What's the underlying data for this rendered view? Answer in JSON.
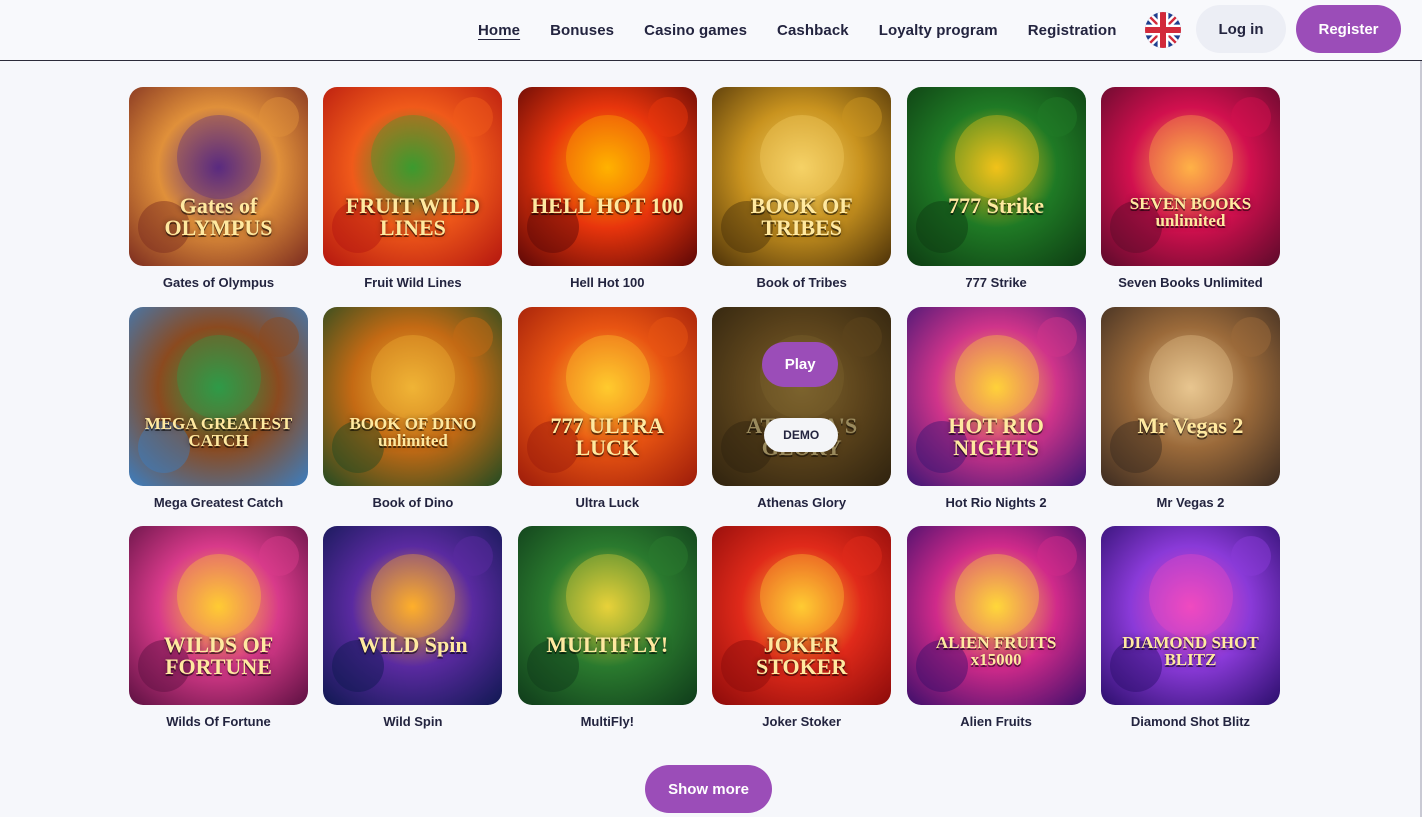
{
  "nav": {
    "items": [
      "Home",
      "Bonuses",
      "Casino games",
      "Cashback",
      "Loyalty program",
      "Registration"
    ],
    "active": "Home"
  },
  "header": {
    "language_icon": "uk-flag-icon",
    "login_label": "Log in",
    "register_label": "Register"
  },
  "colors": {
    "accent": "#9b4db8",
    "text": "#23243f",
    "background": "#f6f7fb"
  },
  "games": [
    {
      "name": "Gates of Olympus",
      "art": "Gates of OLYMPUS",
      "colors": [
        "#7a2a1f",
        "#e0903a",
        "#5a2a80"
      ]
    },
    {
      "name": "Fruit Wild Lines",
      "art": "FRUIT WILD LINES",
      "colors": [
        "#b3150f",
        "#f05a1a",
        "#3b9b2f"
      ]
    },
    {
      "name": "Hell Hot 100",
      "art": "HELL HOT 100",
      "colors": [
        "#5a0606",
        "#e8350c",
        "#ffb300"
      ]
    },
    {
      "name": "Book of Tribes",
      "art": "BOOK OF TRIBES",
      "colors": [
        "#4a3008",
        "#c9931f",
        "#f5d266"
      ]
    },
    {
      "name": "777 Strike",
      "art": "777 Strike",
      "colors": [
        "#0d3a12",
        "#1f7a25",
        "#f2c21a"
      ]
    },
    {
      "name": "Seven Books Unlimited",
      "art": "SEVEN BOOKS unlimited",
      "colors": [
        "#5a0a2a",
        "#d1104e",
        "#ffb347"
      ]
    },
    {
      "name": "Mega Greatest Catch",
      "art": "MEGA GREATEST CATCH",
      "colors": [
        "#3a7fc4",
        "#8b4a1f",
        "#2f9b48"
      ]
    },
    {
      "name": "Book of Dino",
      "art": "BOOK OF DINO unlimited",
      "colors": [
        "#1f4a22",
        "#c46a14",
        "#f0b436"
      ]
    },
    {
      "name": "Ultra Luck",
      "art": "777 ULTRA LUCK",
      "colors": [
        "#9b1a0a",
        "#e85412",
        "#ffcb2e"
      ]
    },
    {
      "name": "Athenas Glory",
      "art": "ATHENA'S GLORY",
      "colors": [
        "#3b2c12",
        "#8f6a2a",
        "#c9a24a"
      ]
    },
    {
      "name": "Hot Rio Nights 2",
      "art": "HOT RIO NIGHTS",
      "colors": [
        "#3a1574",
        "#d0348a",
        "#ffd23a"
      ]
    },
    {
      "name": "Mr Vegas 2",
      "art": "Mr Vegas 2",
      "colors": [
        "#3a2a20",
        "#9b6a3a",
        "#e8c690"
      ]
    },
    {
      "name": "Wilds Of Fortune",
      "art": "WILDS OF FORTUNE",
      "colors": [
        "#5a1040",
        "#d83a8a",
        "#ffcc33"
      ]
    },
    {
      "name": "Wild Spin",
      "art": "WILD Spin",
      "colors": [
        "#0e1850",
        "#5a2aa0",
        "#ffb02a"
      ]
    },
    {
      "name": "MultiFly!",
      "art": "MULTIFLY!",
      "colors": [
        "#0f3a1a",
        "#2a7a2e",
        "#e8d23a"
      ]
    },
    {
      "name": "Joker Stoker",
      "art": "JOKER STOKER",
      "colors": [
        "#8a0a0a",
        "#e02a1a",
        "#ffcc33"
      ]
    },
    {
      "name": "Alien Fruits",
      "art": "ALIEN FRUITS x15000",
      "colors": [
        "#3a0e6a",
        "#d02a8a",
        "#ffd83a"
      ]
    },
    {
      "name": "Diamond Shot Blitz",
      "art": "DIAMOND SHOT BLITZ",
      "colors": [
        "#2a0e6a",
        "#8a3ad8",
        "#f04ac0"
      ]
    }
  ],
  "hover_card": {
    "play_label": "Play",
    "demo_label": "DEMO"
  },
  "show_more_label": "Show more"
}
